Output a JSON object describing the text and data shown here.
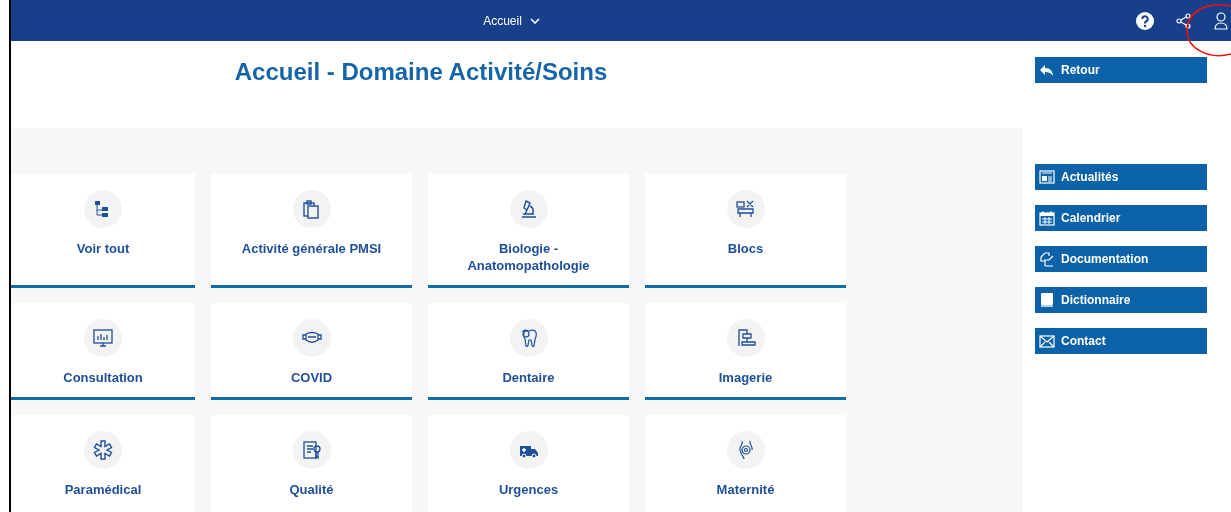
{
  "top_bar": {
    "title": "Accueil"
  },
  "page_title": "Accueil - Domaine Activité/Soins",
  "tiles": [
    {
      "label": "Voir tout"
    },
    {
      "label": "Activité générale PMSI"
    },
    {
      "label": "Biologie - Anatomopathologie"
    },
    {
      "label": "Blocs"
    },
    {
      "label": "Consultation"
    },
    {
      "label": "COVID"
    },
    {
      "label": "Dentaire"
    },
    {
      "label": "Imagerie"
    },
    {
      "label": "Paramédical"
    },
    {
      "label": "Qualité"
    },
    {
      "label": "Urgences"
    },
    {
      "label": "Maternité"
    }
  ],
  "back_button": "Retour",
  "side_links": [
    "Actualités",
    "Calendrier",
    "Documentation",
    "Dictionnaire",
    "Contact"
  ]
}
